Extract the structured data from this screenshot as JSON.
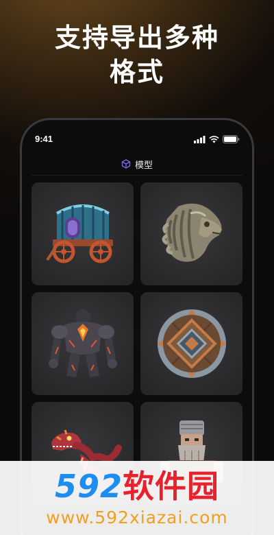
{
  "headline": {
    "line1": "支持导出多种",
    "line2": "格式"
  },
  "status_bar": {
    "time": "9:41",
    "icons": [
      "signal-icon",
      "wifi-icon",
      "battery-icon"
    ]
  },
  "nav": {
    "icon": "cube-icon",
    "title": "模型"
  },
  "models": [
    {
      "name": "wagon-model"
    },
    {
      "name": "lion-head-model"
    },
    {
      "name": "lava-golem-model"
    },
    {
      "name": "round-shield-model"
    },
    {
      "name": "red-dinosaur-model"
    },
    {
      "name": "bearded-warrior-model"
    }
  ],
  "watermark": {
    "logo_number": "592",
    "logo_text": "软件园",
    "url": "www.592xiazai.com"
  },
  "colors": {
    "background": "#0b0a0a",
    "accent_glow": "#6b4a1e",
    "nav_icon": "#7b6cf0",
    "card": "#2c2c2f"
  }
}
